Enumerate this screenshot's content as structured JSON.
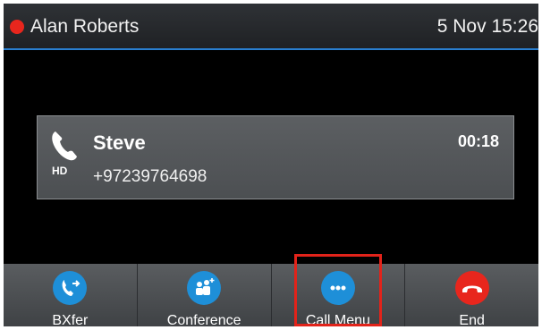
{
  "header": {
    "account_name": "Alan Roberts",
    "datetime": "5 Nov 15:26",
    "status_color": "#e8261d"
  },
  "call": {
    "name": "Steve",
    "number": "+97239764698",
    "duration": "00:18",
    "codec_icon": "hd-icon"
  },
  "softkeys": [
    {
      "label": "BXfer",
      "icon": "blind-transfer-icon",
      "color": "#1e8fd8"
    },
    {
      "label": "Conference",
      "icon": "conference-icon",
      "color": "#1e8fd8"
    },
    {
      "label": "Call Menu",
      "icon": "more-icon",
      "color": "#1e8fd8"
    },
    {
      "label": "End",
      "icon": "hang-up-icon",
      "color": "#e8261d"
    }
  ],
  "highlight": {
    "target": "Call Menu",
    "color": "#e2231a"
  }
}
